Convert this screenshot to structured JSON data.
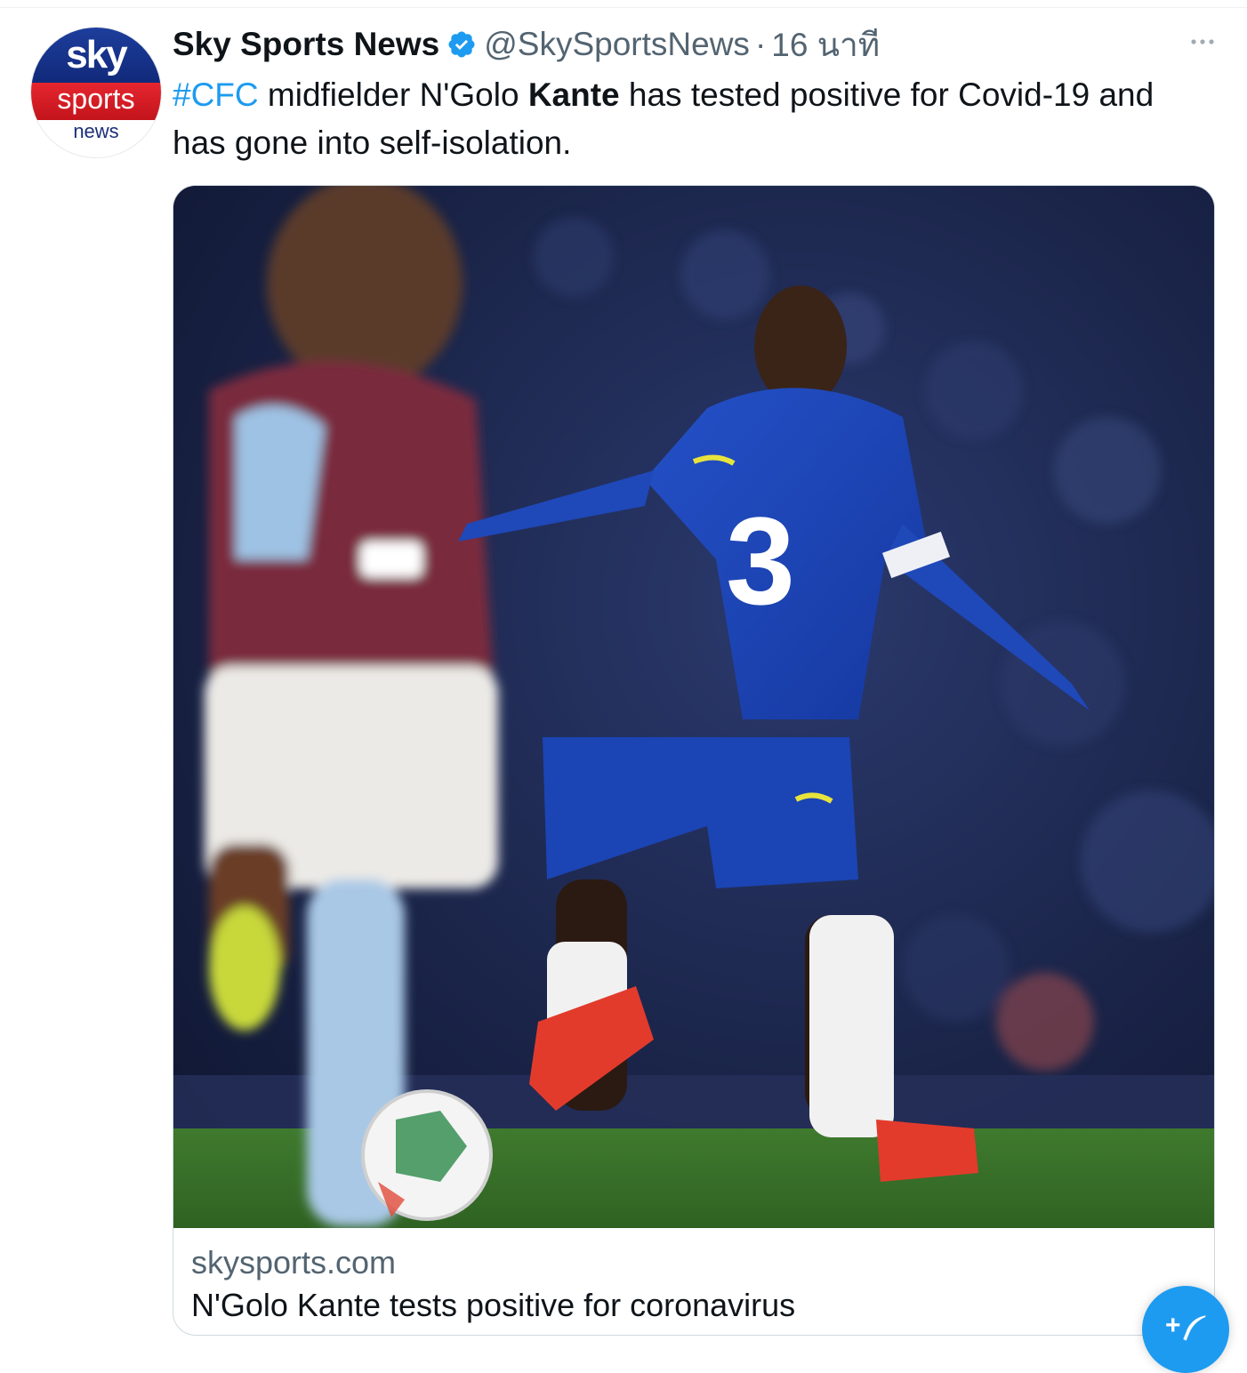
{
  "account": {
    "name": "Sky Sports News",
    "handle": "@SkySportsNews",
    "separator": "·",
    "time": "16 นาที",
    "avatar": {
      "line1": "sky",
      "line2": "sports",
      "line3": "news"
    }
  },
  "tweet": {
    "hashtag": "#CFC",
    "text_part1": " midfielder N'Golo ",
    "bold_word": "Kante",
    "text_part2": " has tested positive for Covid-19 and has gone into self-isolation."
  },
  "card": {
    "domain": "skysports.com",
    "title": "N'Golo Kante tests positive for coronavirus",
    "image_jersey_number": "3"
  },
  "icons": {
    "verified": "verified-badge-icon",
    "more": "more-horizontal-icon",
    "compose": "compose-tweet-icon",
    "compose_glyph": "+"
  },
  "colors": {
    "accent": "#1d9bf0",
    "secondary_text": "#536471",
    "primary_text": "#0f1419",
    "border": "#cfd9de"
  }
}
